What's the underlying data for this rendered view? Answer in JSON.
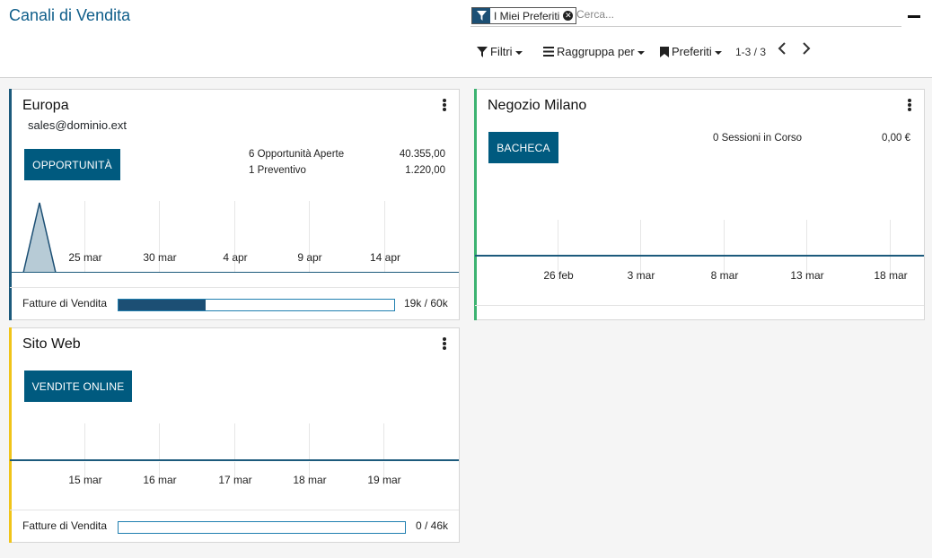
{
  "header": {
    "title": "Canali di Vendita",
    "facet_label": "I Miei Preferiti",
    "search_placeholder": "Cerca...",
    "filters_label": "Filtri",
    "groupby_label": "Raggruppa per",
    "favorites_label": "Preferiti",
    "pager": "1-3 / 3"
  },
  "cards": {
    "europa": {
      "title": "Europa",
      "email": "sales@dominio.ext",
      "button": "OPPORTUNITÀ",
      "stats": [
        {
          "label": "6 Opportunità Aperte",
          "value": "40.355,00"
        },
        {
          "label": "1 Preventivo",
          "value": "1.220,00"
        }
      ],
      "x_ticks": [
        "25 mar",
        "30 mar",
        "4 apr",
        "9 apr",
        "14 apr"
      ],
      "footer_label": "Fatture di Vendita",
      "progress_value": 19,
      "progress_max": 60,
      "progress_text": "19k / 60k",
      "accent": "#1c5a7c"
    },
    "milano": {
      "title": "Negozio Milano",
      "button": "BACHECA",
      "sessions": "0 Sessioni in Corso",
      "amount": "0,00 €",
      "x_ticks": [
        "26 feb",
        "3 mar",
        "8 mar",
        "13 mar",
        "18 mar"
      ],
      "accent": "#3cb371"
    },
    "sito": {
      "title": "Sito Web",
      "button": "VENDITE ONLINE",
      "x_ticks": [
        "15 mar",
        "16 mar",
        "17 mar",
        "18 mar",
        "19 mar"
      ],
      "footer_label": "Fatture di Vendita",
      "progress_value": 0,
      "progress_max": 46,
      "progress_text": "0 / 46k",
      "accent": "#f0c419"
    }
  }
}
